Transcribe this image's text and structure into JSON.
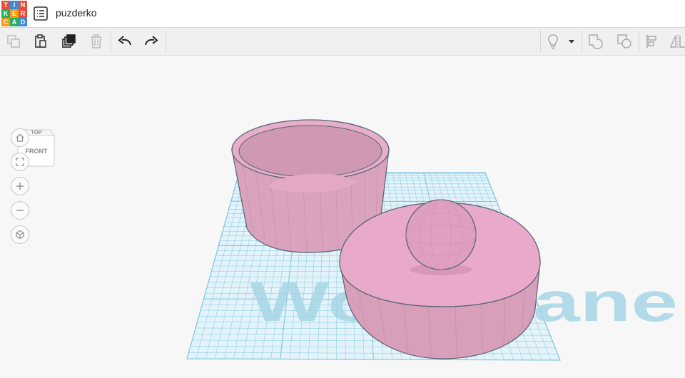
{
  "app": {
    "logo_letters": [
      "T",
      "I",
      "N",
      "K",
      "E",
      "R",
      "C",
      "A",
      "D"
    ],
    "logo_colors": [
      "#e74c3c",
      "#3b8ad9",
      "#e74c3c",
      "#27ae60",
      "#f39c12",
      "#e74c3c",
      "#f39c12",
      "#27ae60",
      "#3b8ad9"
    ],
    "design_title": "puzderko"
  },
  "toolbar": {
    "left_tools": [
      "copy-icon",
      "paste-icon",
      "duplicate-icon",
      "delete-icon",
      "undo-icon",
      "redo-icon"
    ],
    "right_tools": [
      "light-bulb-icon",
      "dropdown-icon",
      "shape-group-icon",
      "shape-hole-icon",
      "align-icon",
      "mirror-icon"
    ]
  },
  "viewcube": {
    "top_label": "TOP",
    "front_label": "FRONT"
  },
  "nav_controls": [
    "home-view-icon",
    "fit-all-icon",
    "zoom-in-icon",
    "zoom-out-icon",
    "ortho-view-icon"
  ],
  "workplane": {
    "watermark": "Workplane"
  },
  "colors": {
    "shape": "#e6a8c6",
    "shape_edge": "#5a6475",
    "grid_line": "#7ec8de",
    "grid_fill": "#def1f8"
  }
}
